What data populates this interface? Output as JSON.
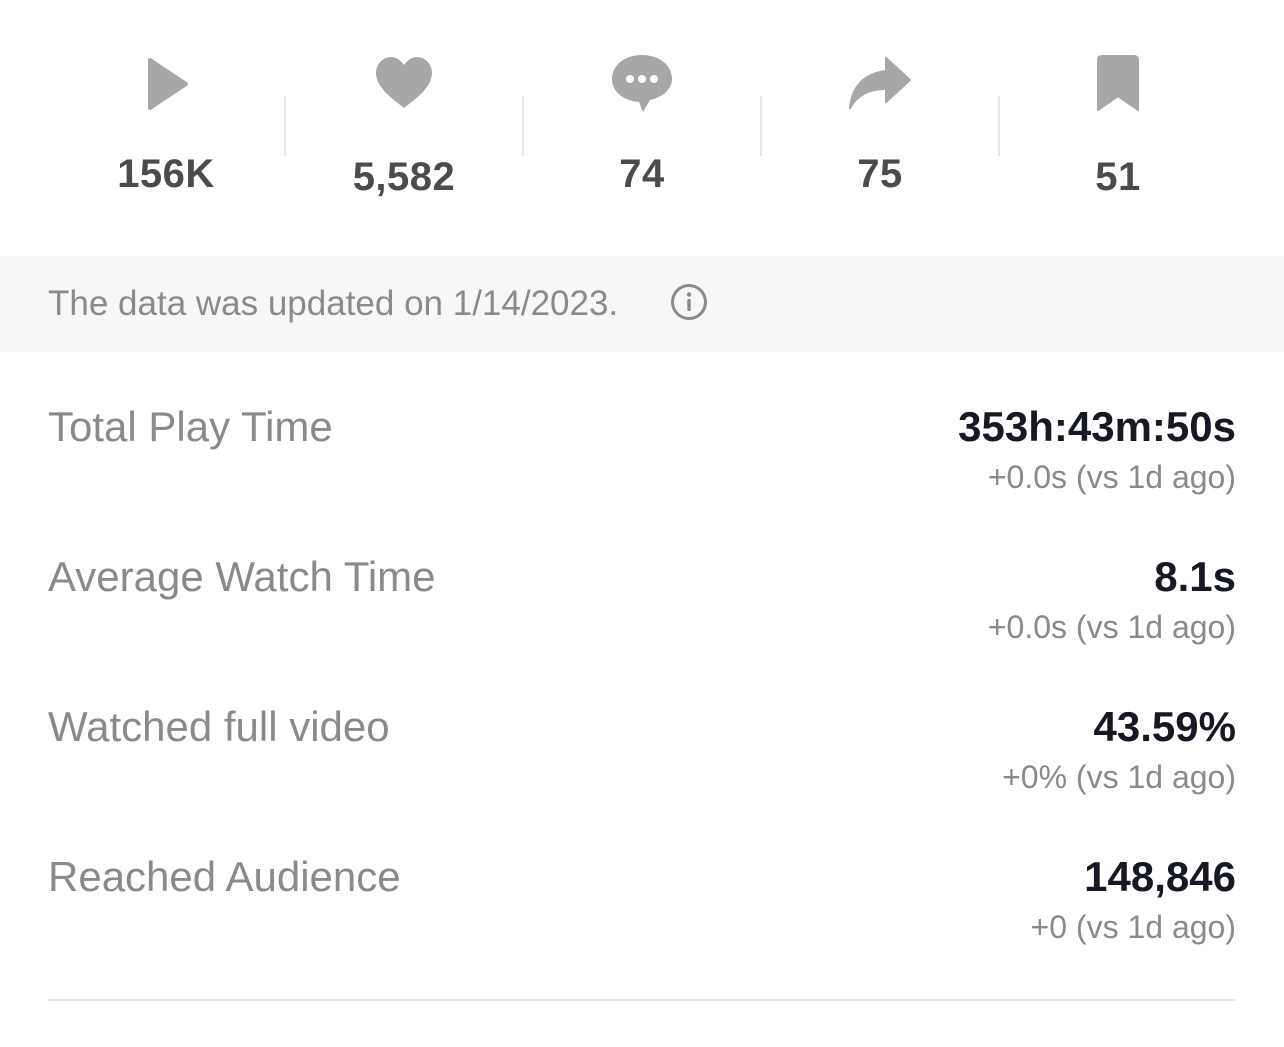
{
  "stats": [
    {
      "icon": "play-icon",
      "count": "156K"
    },
    {
      "icon": "heart-icon",
      "count": "5,582"
    },
    {
      "icon": "comment-icon",
      "count": "74"
    },
    {
      "icon": "share-icon",
      "count": "75"
    },
    {
      "icon": "bookmark-icon",
      "count": "51"
    }
  ],
  "banner": {
    "text": "The data was updated on 1/14/2023.",
    "icon": "info-icon"
  },
  "metrics": [
    {
      "label": "Total Play Time",
      "value": "353h:43m:50s",
      "delta": "+0.0s (vs 1d ago)"
    },
    {
      "label": "Average Watch Time",
      "value": "8.1s",
      "delta": "+0.0s (vs 1d ago)"
    },
    {
      "label": "Watched full video",
      "value": "43.59%",
      "delta": "+0% (vs 1d ago)"
    },
    {
      "label": "Reached Audience",
      "value": "148,846",
      "delta": "+0 (vs 1d ago)"
    }
  ],
  "colors": {
    "icon_gray": "#a7a7aa",
    "count_text": "#4b4b4d",
    "label_gray": "#8a8a8e",
    "value_dark": "#161823",
    "banner_bg": "#f7f7f8",
    "divider": "#e6e6e8"
  }
}
